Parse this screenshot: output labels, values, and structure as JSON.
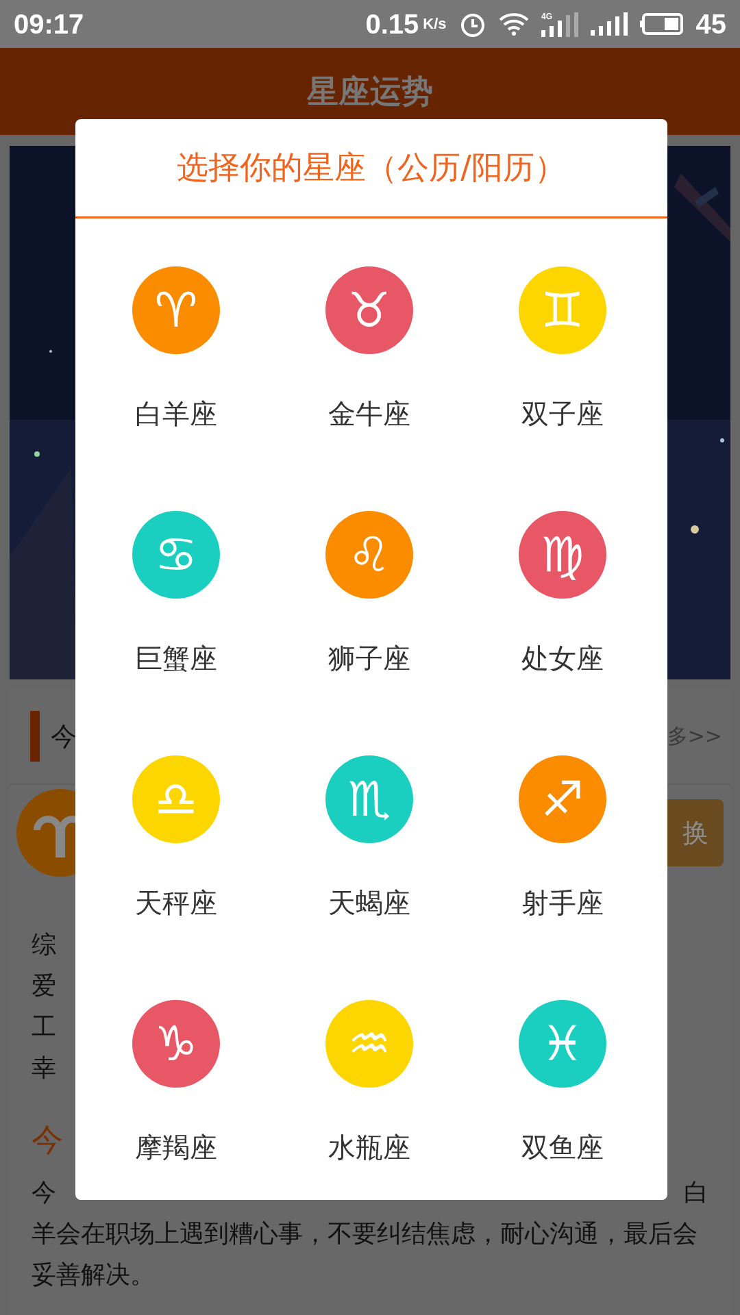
{
  "status_bar": {
    "time": "09:17",
    "speed": "0.15",
    "speed_unit": "K/s",
    "network": "4G",
    "battery": "45"
  },
  "header": {
    "title": "星座运势"
  },
  "background": {
    "section_title": "今",
    "more_link": "多>>",
    "switch_button": "换",
    "info_lines": [
      {
        "left": "综"
      },
      {
        "left": "爱"
      },
      {
        "left": "工"
      },
      {
        "left": "幸"
      }
    ],
    "heading": "今",
    "paragraph": [
      {
        "left": "今",
        "right": "白"
      },
      {
        "left": "羊会在职场上遇到糟心事，不要纠结焦虑，耐心沟通，最后会"
      },
      {
        "left": "妥善解决。"
      }
    ]
  },
  "dialog": {
    "title": "选择你的星座（公历/阳历）",
    "signs": [
      {
        "name": "白羊座",
        "symbol": "♈",
        "color": "#fb8c00"
      },
      {
        "name": "金牛座",
        "symbol": "♉",
        "color": "#e85766"
      },
      {
        "name": "双子座",
        "symbol": "♊",
        "color": "#fdd600"
      },
      {
        "name": "巨蟹座",
        "symbol": "♋",
        "color": "#1bcfc0"
      },
      {
        "name": "狮子座",
        "symbol": "♌",
        "color": "#fb8c00"
      },
      {
        "name": "处女座",
        "symbol": "♍",
        "color": "#e85766"
      },
      {
        "name": "天秤座",
        "symbol": "♎",
        "color": "#fdd600"
      },
      {
        "name": "天蝎座",
        "symbol": "♏",
        "color": "#1bcfc0"
      },
      {
        "name": "射手座",
        "symbol": "♐",
        "color": "#fb8c00"
      },
      {
        "name": "摩羯座",
        "symbol": "♑",
        "color": "#e85766"
      },
      {
        "name": "水瓶座",
        "symbol": "♒",
        "color": "#fdd600"
      },
      {
        "name": "双鱼座",
        "symbol": "♓",
        "color": "#1bcfc0"
      }
    ]
  }
}
